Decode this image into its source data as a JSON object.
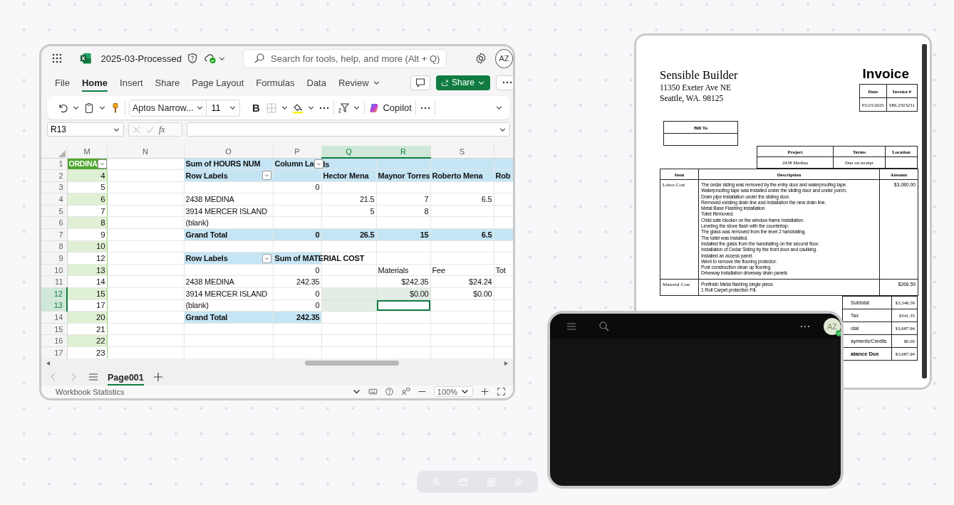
{
  "excel": {
    "title": "2025-03-Processed",
    "search": {
      "placeholder": "Search for tools, help, and more (Alt + Q)"
    },
    "avatar": "AZ",
    "menu_tabs": [
      {
        "label": "File",
        "selected": false
      },
      {
        "label": "Home",
        "selected": true
      },
      {
        "label": "Insert",
        "selected": false
      },
      {
        "label": "Share",
        "selected": false
      },
      {
        "label": "Page Layout",
        "selected": false
      },
      {
        "label": "Formulas",
        "selected": false
      },
      {
        "label": "Data",
        "selected": false
      },
      {
        "label": "Review",
        "selected": false
      }
    ],
    "share_button": "Share",
    "ribbon": {
      "font": "Aptos Narrow...",
      "font_size": "11",
      "bold": "B",
      "copilot": "Copilot"
    },
    "formula_bar": {
      "name_box": "R13",
      "fx": "fx"
    },
    "columns": [
      {
        "label": "M",
        "selected": false
      },
      {
        "label": "N",
        "selected": false
      },
      {
        "label": "O",
        "selected": false
      },
      {
        "label": "P",
        "selected": false
      },
      {
        "label": "Q",
        "selected": true
      },
      {
        "label": "R",
        "selected": true
      },
      {
        "label": "S",
        "selected": false
      }
    ],
    "rows": [
      {
        "number": "1",
        "selected": false,
        "cells": [
          {
            "text": "ORDINA",
            "kind": "ordinal-title",
            "filter": true
          },
          {
            "kind": "empty"
          },
          {
            "text": "Sum of HOURS NUM",
            "kind": "header"
          },
          {
            "text": "Column La",
            "kind": "header",
            "filter": true
          },
          {
            "text": "ls",
            "kind": "header"
          },
          {
            "kind": "header"
          },
          {
            "kind": "header"
          },
          {
            "kind": "header"
          }
        ]
      },
      {
        "number": "2",
        "selected": false,
        "cells": [
          {
            "text": "4",
            "kind": "ordinal-band"
          },
          {
            "kind": "empty"
          },
          {
            "text": "Row Labels",
            "kind": "header",
            "filter": true
          },
          {
            "kind": "header"
          },
          {
            "text": "Hector Mena",
            "kind": "header"
          },
          {
            "text": "Maynor Torres",
            "kind": "header"
          },
          {
            "text": "Roberto Mena",
            "kind": "header"
          },
          {
            "text": "Rob",
            "kind": "header"
          }
        ]
      },
      {
        "number": "3",
        "selected": false,
        "cells": [
          {
            "text": "5",
            "kind": "ordinal"
          },
          {
            "kind": "empty"
          },
          {
            "kind": "empty"
          },
          {
            "text": "0",
            "kind": "number"
          },
          {
            "kind": "empty"
          },
          {
            "kind": "empty"
          },
          {
            "kind": "empty"
          },
          {
            "kind": "empty"
          }
        ]
      },
      {
        "number": "4",
        "selected": false,
        "cells": [
          {
            "text": "6",
            "kind": "ordinal-band"
          },
          {
            "kind": "empty"
          },
          {
            "text": "2438 MEDINA",
            "kind": "text"
          },
          {
            "kind": "empty"
          },
          {
            "text": "21.5",
            "kind": "number"
          },
          {
            "text": "7",
            "kind": "number"
          },
          {
            "text": "6.5",
            "kind": "number"
          },
          {
            "kind": "empty"
          }
        ]
      },
      {
        "number": "5",
        "selected": false,
        "cells": [
          {
            "text": "7",
            "kind": "ordinal"
          },
          {
            "kind": "empty"
          },
          {
            "text": "3914 MERCER ISLAND",
            "kind": "text"
          },
          {
            "kind": "empty"
          },
          {
            "text": "5",
            "kind": "number"
          },
          {
            "text": "8",
            "kind": "number"
          },
          {
            "kind": "empty"
          },
          {
            "kind": "empty"
          }
        ]
      },
      {
        "number": "6",
        "selected": false,
        "cells": [
          {
            "text": "8",
            "kind": "ordinal-band"
          },
          {
            "kind": "empty"
          },
          {
            "text": "(blank)",
            "kind": "text"
          },
          {
            "kind": "empty"
          },
          {
            "kind": "empty"
          },
          {
            "kind": "empty"
          },
          {
            "kind": "empty"
          },
          {
            "kind": "empty"
          }
        ]
      },
      {
        "number": "7",
        "selected": false,
        "cells": [
          {
            "text": "9",
            "kind": "ordinal"
          },
          {
            "kind": "empty"
          },
          {
            "text": "Grand Total",
            "kind": "total"
          },
          {
            "text": "0",
            "kind": "total-number"
          },
          {
            "text": "26.5",
            "kind": "total-number"
          },
          {
            "text": "15",
            "kind": "total-number"
          },
          {
            "text": "6.5",
            "kind": "total-number"
          },
          {
            "kind": "total"
          }
        ]
      },
      {
        "number": "8",
        "selected": false,
        "cells": [
          {
            "text": "10",
            "kind": "ordinal-band"
          },
          {
            "kind": "empty"
          },
          {
            "kind": "empty"
          },
          {
            "kind": "empty"
          },
          {
            "kind": "empty"
          },
          {
            "kind": "empty"
          },
          {
            "kind": "empty"
          },
          {
            "kind": "empty"
          }
        ]
      },
      {
        "number": "9",
        "selected": false,
        "cells": [
          {
            "text": "12",
            "kind": "ordinal"
          },
          {
            "kind": "empty"
          },
          {
            "text": "Row Labels",
            "kind": "header",
            "filter": true
          },
          {
            "text": "Sum of MATERIAL COST",
            "kind": "header"
          },
          {
            "kind": "empty"
          },
          {
            "kind": "empty"
          },
          {
            "kind": "empty"
          },
          {
            "kind": "empty"
          }
        ]
      },
      {
        "number": "10",
        "selected": false,
        "cells": [
          {
            "text": "13",
            "kind": "ordinal-band"
          },
          {
            "kind": "empty"
          },
          {
            "kind": "empty"
          },
          {
            "text": "0",
            "kind": "number"
          },
          {
            "kind": "empty"
          },
          {
            "text": "Materials",
            "kind": "text"
          },
          {
            "text": "Fee",
            "kind": "text"
          },
          {
            "text": "Tot",
            "kind": "text"
          }
        ]
      },
      {
        "number": "11",
        "selected": false,
        "cells": [
          {
            "text": "14",
            "kind": "ordinal"
          },
          {
            "kind": "empty"
          },
          {
            "text": "2438 MEDINA",
            "kind": "text"
          },
          {
            "text": "242.35",
            "kind": "number"
          },
          {
            "kind": "empty"
          },
          {
            "text": "$242.35",
            "kind": "number"
          },
          {
            "text": "$24.24",
            "kind": "number"
          },
          {
            "kind": "empty"
          }
        ]
      },
      {
        "number": "12",
        "selected": true,
        "cells": [
          {
            "text": "15",
            "kind": "ordinal-band"
          },
          {
            "kind": "empty"
          },
          {
            "text": "3914 MERCER ISLAND",
            "kind": "text"
          },
          {
            "text": "0",
            "kind": "number"
          },
          {
            "kind": "selection"
          },
          {
            "text": "$0.00",
            "kind": "selection"
          },
          {
            "text": "$0.00",
            "kind": "number"
          },
          {
            "kind": "empty"
          }
        ]
      },
      {
        "number": "13",
        "selected": true,
        "cells": [
          {
            "text": "17",
            "kind": "ordinal"
          },
          {
            "kind": "empty"
          },
          {
            "text": "(blank)",
            "kind": "text"
          },
          {
            "text": "0",
            "kind": "number"
          },
          {
            "kind": "selection"
          },
          {
            "kind": "active"
          },
          {
            "kind": "empty"
          },
          {
            "kind": "empty"
          }
        ]
      },
      {
        "number": "14",
        "selected": false,
        "cells": [
          {
            "text": "20",
            "kind": "ordinal-band"
          },
          {
            "kind": "empty"
          },
          {
            "text": "Grand Total",
            "kind": "total"
          },
          {
            "text": "242.35",
            "kind": "total-number"
          },
          {
            "kind": "empty"
          },
          {
            "kind": "empty"
          },
          {
            "kind": "empty"
          },
          {
            "kind": "empty"
          }
        ]
      },
      {
        "number": "15",
        "selected": false,
        "cells": [
          {
            "text": "21",
            "kind": "ordinal"
          },
          {
            "kind": "empty"
          },
          {
            "kind": "empty"
          },
          {
            "kind": "empty"
          },
          {
            "kind": "empty"
          },
          {
            "kind": "empty"
          },
          {
            "kind": "empty"
          },
          {
            "kind": "empty"
          }
        ]
      },
      {
        "number": "16",
        "selected": false,
        "cells": [
          {
            "text": "22",
            "kind": "ordinal-band"
          },
          {
            "kind": "empty"
          },
          {
            "kind": "empty"
          },
          {
            "kind": "empty"
          },
          {
            "kind": "empty"
          },
          {
            "kind": "empty"
          },
          {
            "kind": "empty"
          },
          {
            "kind": "empty"
          }
        ]
      },
      {
        "number": "17",
        "selected": false,
        "cells": [
          {
            "text": "23",
            "kind": "ordinal"
          },
          {
            "kind": "empty"
          },
          {
            "kind": "empty"
          },
          {
            "kind": "empty"
          },
          {
            "kind": "empty"
          },
          {
            "kind": "empty"
          },
          {
            "kind": "empty"
          },
          {
            "kind": "empty"
          }
        ]
      }
    ],
    "sheet_tabs": [
      {
        "label": "Page001",
        "selected": true
      }
    ],
    "status_bar": {
      "label": "Workbook Statistics",
      "zoom": "100%"
    }
  },
  "invoice": {
    "company": "Sensible Builder",
    "address": [
      "11350 Exeter Ave NE",
      "Seattle, WA. 98125"
    ],
    "title": "Invoice",
    "meta": {
      "headers": [
        "Date",
        "Invoice #"
      ],
      "values": [
        "03/23/2025",
        "SBL2503231"
      ]
    },
    "bill_to": "Bill To",
    "project": {
      "headers": [
        "Project",
        "Terms",
        "Location"
      ],
      "values": [
        "2438 Medina",
        "Due on receipt"
      ]
    },
    "items": {
      "headers": [
        "Item",
        "Description",
        "Amount"
      ],
      "rows": [
        {
          "item": "Labor Cost",
          "amount": "$3,080.00",
          "lines": [
            "The cedar siding was removed by the entry door and waterproofing tape.",
            "Waterproofing tape was installed under the sliding door and under porch.",
            "Drain pipe installation under the sliding door.",
            "Removed existing drain line and installation the new drain line.",
            "Metal Base Flashing installation.",
            "Toilet Removed.",
            "Child safe blocker on the window frame Installation.",
            "Leveling the stove flash with the countertop.",
            "The glass was removed from the level 2 handrailing.",
            "The toilet was installed.",
            "Installed the glass from the handrailing on the second floor.",
            "Installation of Cedar Siding by the front door and caulking.",
            "Installed an access panel.",
            "Went to remove the flooring protector.",
            "Post construction clean up flooring.",
            "Driveway installation driveway drain panels"
          ]
        },
        {
          "item": "Material Cost",
          "amount": "$266.59",
          "lines": [
            "Prefinish Metal flashing single piece.",
            "1 Roll Carpet protection Fill."
          ]
        }
      ]
    },
    "totals": [
      {
        "label": "Subtotal",
        "amount": "$3,346.59",
        "kind": "line"
      },
      {
        "label": "Tax",
        "amount": "$341.35",
        "kind": "line"
      },
      {
        "label": "otal",
        "amount": "$3,687.94",
        "kind": "line"
      },
      {
        "label": "ayments/Credits",
        "amount": "$0.00",
        "kind": "line"
      },
      {
        "label": "alance Due",
        "amount": "$3,687.94",
        "kind": "due"
      }
    ]
  },
  "dark_panel": {
    "avatar": "AZ"
  }
}
